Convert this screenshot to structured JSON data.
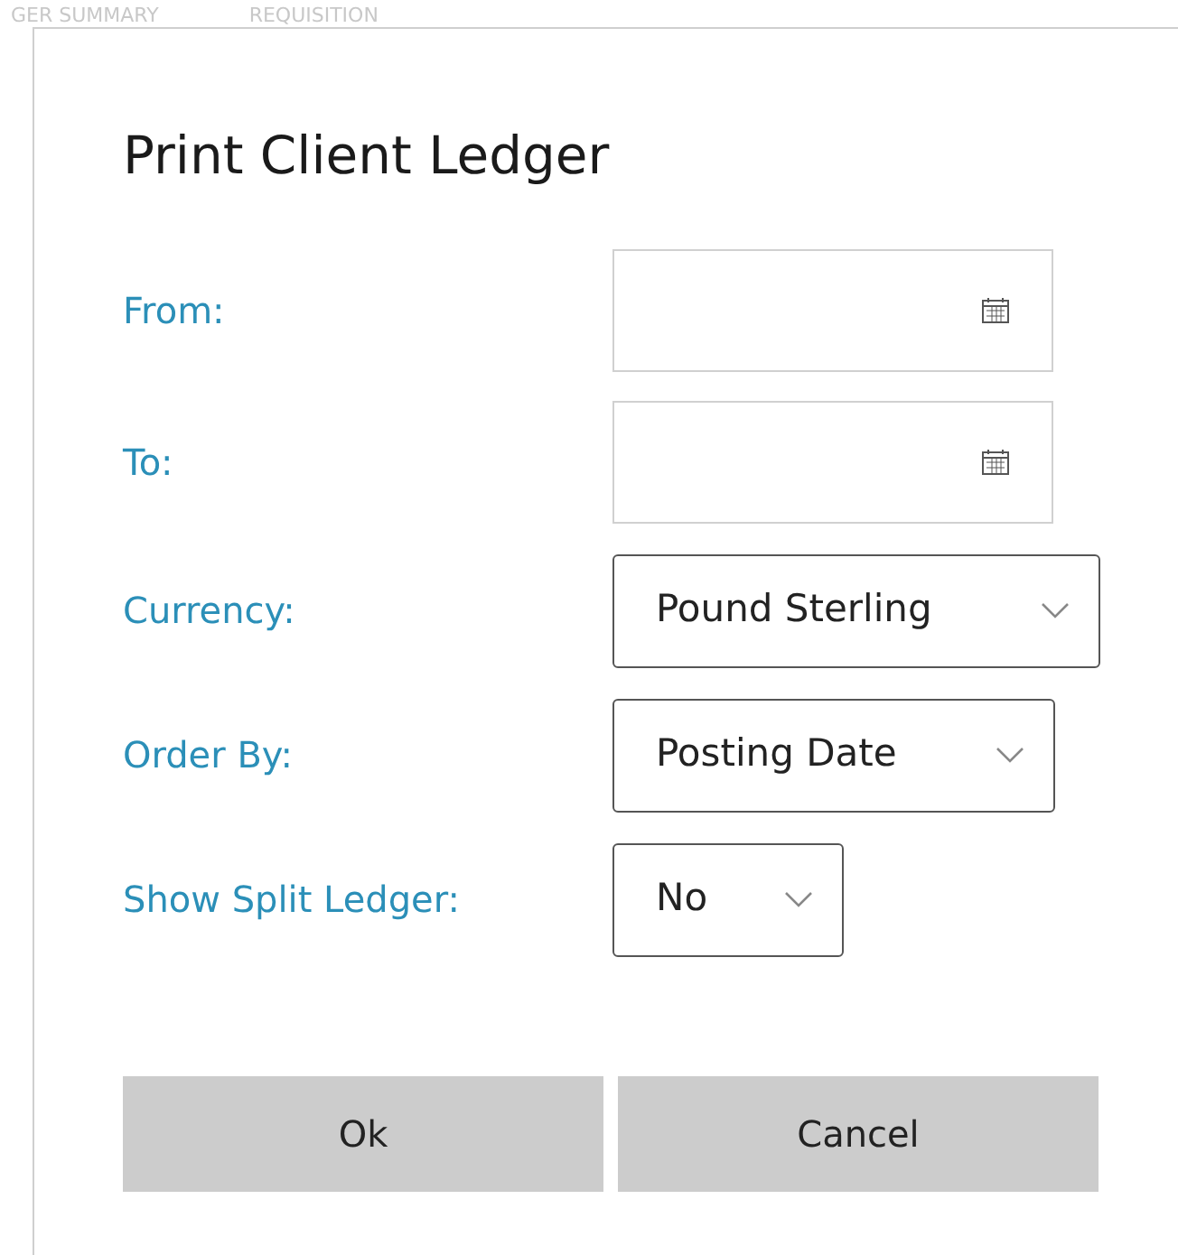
{
  "background_tabs": [
    "GER SUMMARY",
    "REQUISITION"
  ],
  "dialog": {
    "title": "Print Client Ledger",
    "fields": [
      {
        "label": "From:",
        "kind": "date"
      },
      {
        "label": "To:",
        "kind": "date"
      },
      {
        "label": "Currency:",
        "kind": "select",
        "value": "Pound Sterling"
      },
      {
        "label": "Order By:",
        "kind": "select",
        "value": "Posting Date"
      },
      {
        "label": "Show Split Ledger:",
        "kind": "select",
        "value": "No"
      }
    ],
    "buttons": [
      "Ok",
      "Cancel"
    ]
  }
}
